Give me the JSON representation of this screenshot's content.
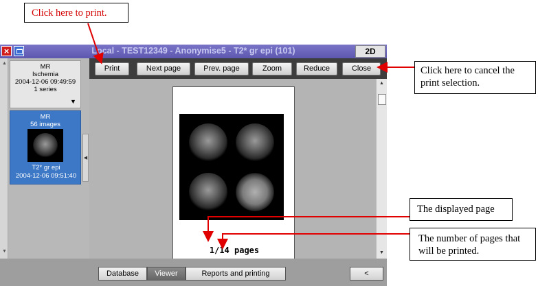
{
  "callouts": {
    "print": "Click here to print.",
    "cancel_line1": "Click here to cancel the",
    "cancel_line2": "print selection.",
    "displayed_page": "The displayed page",
    "pages_line1": "The number of pages that",
    "pages_line2": "will be printed."
  },
  "window": {
    "title": "Local - TEST12349 - Anonymise5 - T2* gr epi (101)",
    "mode": "2D"
  },
  "series": [
    {
      "modality": "MR",
      "description": "Ischemia",
      "datetime": "2004-12-06 09:49:59",
      "count": "1 series"
    },
    {
      "modality": "MR",
      "count": "56 images",
      "description": "T2* gr epi",
      "datetime": "2004-12-06 09:51:40"
    }
  ],
  "toolbar": {
    "print": "Print",
    "next_page": "Next page",
    "prev_page": "Prev. page",
    "zoom": "Zoom",
    "reduce": "Reduce",
    "close": "Close"
  },
  "page_info": "1/14 pages",
  "bottom_tabs": {
    "database": "Database",
    "viewer": "Viewer",
    "reports": "Reports and printing",
    "back": "<"
  },
  "colors": {
    "callout_red": "#d40000",
    "arrow_red": "#e00000",
    "titlebar": "#6b65bd",
    "selected_series": "#3d78c6"
  }
}
